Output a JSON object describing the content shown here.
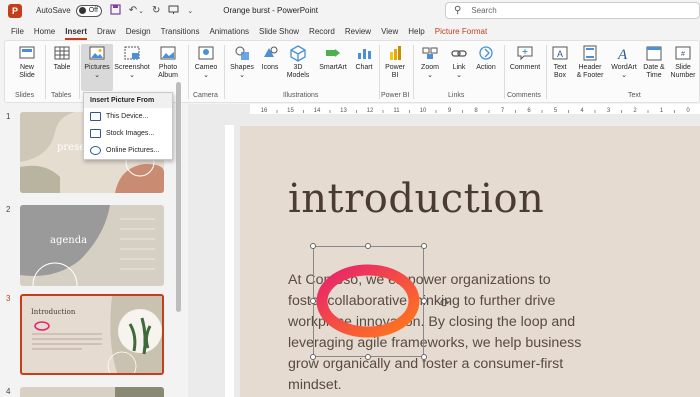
{
  "titlebar": {
    "app_icon": "P",
    "autosave_label": "AutoSave",
    "autosave_state": "Off",
    "doc_title": "Orange burst  -  PowerPoint",
    "search_placeholder": "Search"
  },
  "tabs": [
    "File",
    "Home",
    "Insert",
    "Draw",
    "Design",
    "Transitions",
    "Animations",
    "Slide Show",
    "Record",
    "Review",
    "View",
    "Help",
    "Picture Format"
  ],
  "ribbon": {
    "buttons": {
      "new_slide": "New\nSlide",
      "table": "Table",
      "pictures": "Pictures",
      "screenshot": "Screenshot",
      "photo_album": "Photo\nAlbum",
      "cameo": "Cameo",
      "shapes": "Shapes",
      "icons": "Icons",
      "models_3d": "3D\nModels",
      "smartart": "SmartArt",
      "chart": "Chart",
      "power_bi": "Power\nBI",
      "zoom": "Zoom",
      "link": "Link",
      "action": "Action",
      "comment": "Comment",
      "text_box": "Text\nBox",
      "header_footer": "Header\n& Footer",
      "wordart": "WordArt",
      "date_time": "Date &\nTime",
      "slide_number": "Slide\nNumber"
    },
    "groups": {
      "slides": "Slides",
      "tables": "Tables",
      "camera": "Camera",
      "illustrations": "Illustrations",
      "power_bi": "Power BI",
      "links": "Links",
      "comments": "Comments",
      "text": "Text"
    }
  },
  "dropdown": {
    "header": "Insert Picture From",
    "items": [
      "This Device...",
      "Stock Images...",
      "Online Pictures..."
    ]
  },
  "thumbnails": [
    {
      "number": "1",
      "title": "presen"
    },
    {
      "number": "2",
      "title": "agenda"
    },
    {
      "number": "3",
      "title": "Introduction"
    },
    {
      "number": "4",
      "title": ""
    }
  ],
  "ruler": {
    "labels": [
      "16",
      "15",
      "14",
      "13",
      "12",
      "11",
      "10",
      "9",
      "8",
      "7",
      "6",
      "5",
      "4",
      "3",
      "2",
      "1",
      "0"
    ]
  },
  "slide": {
    "title": "introduction",
    "body": "At Contoso, we empower organizations to foster collaborative thinking to further drive workplace innovation. By closing the loop and leveraging agile frameworks, we help business grow organically and foster a consumer-first mindset."
  },
  "colors": {
    "accent": "#c43e1c",
    "slide_bg": "#e5dbd0",
    "title_text": "#4a3b33",
    "burst_start": "#e8206f",
    "burst_end": "#ff7a1a"
  }
}
